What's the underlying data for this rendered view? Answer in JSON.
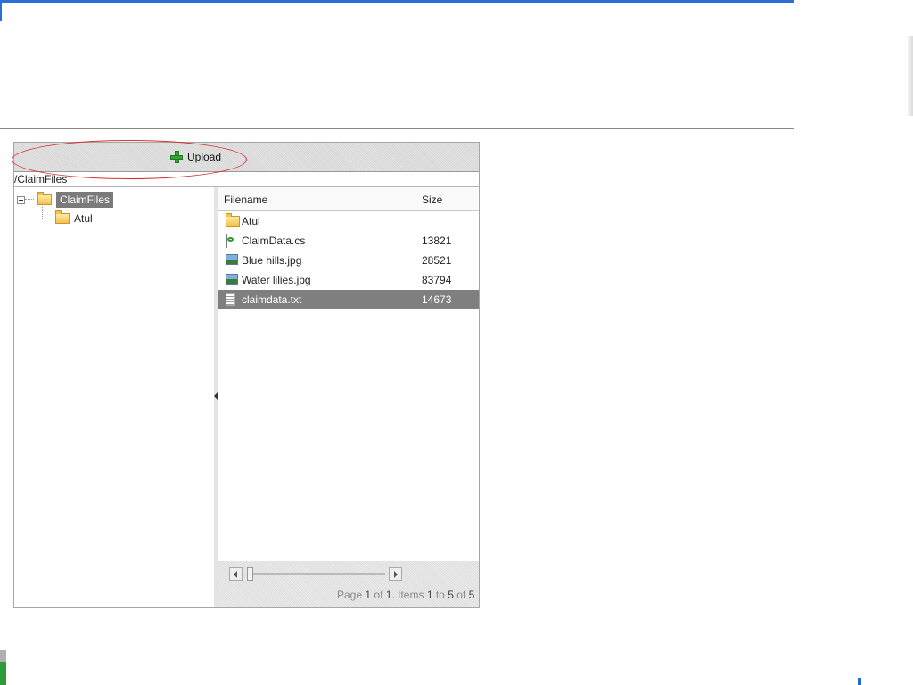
{
  "toolbar": {
    "upload_label": "Upload",
    "upload_icon": "plus-icon"
  },
  "path_bar": {
    "current_path": "/ClaimFiles"
  },
  "tree": {
    "root": {
      "label": "ClaimFiles",
      "icon": "folder-icon",
      "expanded": true,
      "selected": true
    },
    "children": [
      {
        "label": "Atul",
        "icon": "folder-icon"
      }
    ]
  },
  "grid": {
    "columns": {
      "filename": "Filename",
      "size": "Size"
    },
    "rows": [
      {
        "name": "Atul",
        "size": "",
        "icon": "folder-icon",
        "selected": false
      },
      {
        "name": "ClaimData.cs",
        "size": "13821",
        "icon": "cs-file-icon",
        "selected": false
      },
      {
        "name": "Blue hills.jpg",
        "size": "28521",
        "icon": "image-file-icon",
        "selected": false
      },
      {
        "name": "Water lilies.jpg",
        "size": "83794",
        "icon": "image-file-icon",
        "selected": false
      },
      {
        "name": "claimdata.txt",
        "size": "14673",
        "icon": "text-file-icon",
        "selected": true
      }
    ]
  },
  "pager": {
    "page_label": "Page",
    "page": "1",
    "of_label": "of",
    "page_count": "1.",
    "items_label": "Items",
    "from": "1",
    "to_label": "to",
    "to": "5",
    "of_label2": "of",
    "total": "5"
  },
  "colors": {
    "selection": "#7f7f7f",
    "highlight_oval": "#d23030",
    "top_strip": "#2a6fd8"
  }
}
